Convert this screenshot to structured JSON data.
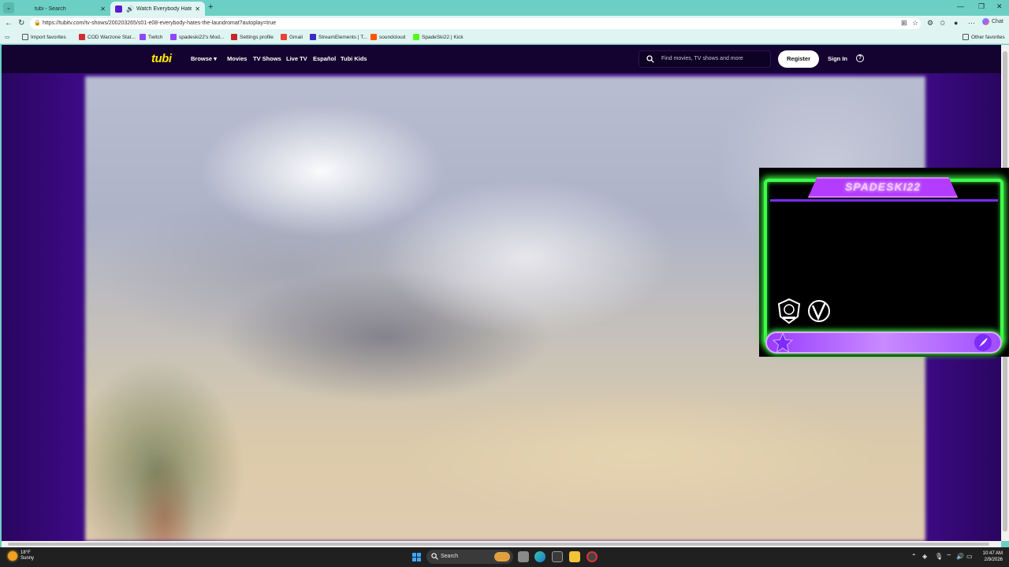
{
  "browser": {
    "tabs": [
      {
        "title": "tubi - Search",
        "active": false
      },
      {
        "title": "Watch Everybody Hates Chris",
        "active": true
      }
    ],
    "url": "https://tubitv.com/tv-shows/200203265/s01-e08-everybody-hates-the-laundromat?autoplay=true",
    "chat_label": "Chat",
    "favorites": [
      {
        "label": "Import favorites",
        "color": "#555555"
      },
      {
        "label": "COD Warzone Stat...",
        "color": "#d32f2f"
      },
      {
        "label": "Twitch",
        "color": "#9146ff"
      },
      {
        "label": "spadeski22's Mod...",
        "color": "#9146ff"
      },
      {
        "label": "Settings profile",
        "color": "#c62828"
      },
      {
        "label": "Gmail",
        "color": "#ea4335"
      },
      {
        "label": "StreamElements | T...",
        "color": "#3b2dbd"
      },
      {
        "label": "soundcloud",
        "color": "#ff5500"
      },
      {
        "label": "SpadeSki22 | Kick",
        "color": "#53fc18"
      }
    ],
    "other_favorites": "Other favorites"
  },
  "tubi": {
    "logo": "tubi",
    "nav": [
      "Browse ▾",
      "Movies",
      "TV Shows",
      "Live TV",
      "Español",
      "Tubi Kids"
    ],
    "search_placeholder": "Find movies, TV shows and more",
    "register": "Register",
    "sign_in": "Sign In",
    "help": "?"
  },
  "overlay": {
    "title": "SPADESKI22",
    "colors": {
      "frame": "#3dff4a",
      "accent": "#b43cff"
    }
  },
  "taskbar": {
    "weather_temp": "18°F",
    "weather_cond": "Sunny",
    "search_label": "Search",
    "time": "10:47 AM",
    "date": "2/9/2026"
  }
}
